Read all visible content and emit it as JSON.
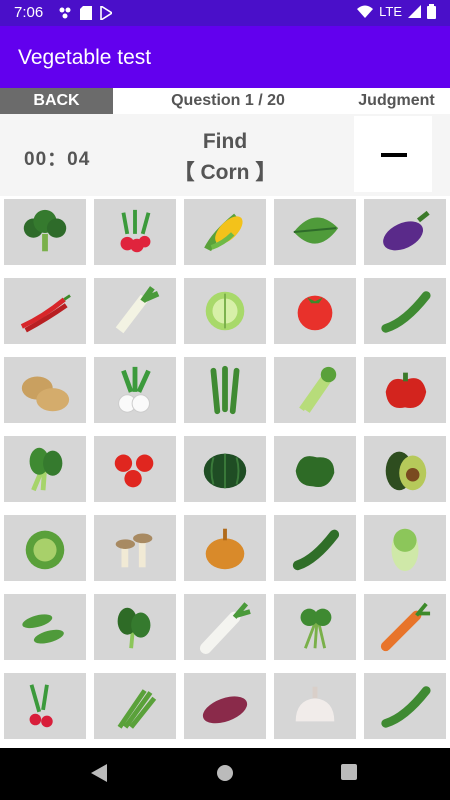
{
  "status": {
    "time": "7:06",
    "network": "LTE"
  },
  "app": {
    "title": "Vegetable test"
  },
  "header": {
    "back_label": "BACK",
    "question": "Question 1 / 20",
    "judgment_label": "Judgment"
  },
  "info": {
    "timer": "00：04",
    "find_line1": "Find",
    "find_line2": "【 Corn 】"
  },
  "colors": {
    "appbar": "#6200ee",
    "statusbar": "#4a0fc9",
    "cell_bg": "#d6d6d6",
    "back_bg": "#6b6b6b"
  },
  "grid": [
    [
      "broccoli-icon",
      "radish-icon",
      "corn-icon",
      "shiso-leaf-icon",
      "eggplant-icon"
    ],
    [
      "red-chili-icon",
      "leek-icon",
      "lettuce-icon",
      "tomato-icon",
      "cucumber-icon"
    ],
    [
      "potato-icon",
      "turnip-icon",
      "okra-icon",
      "celery-icon",
      "red-paprika-icon"
    ],
    [
      "komatsuna-icon",
      "cherry-tomato-icon",
      "kabocha-icon",
      "green-pepper-icon",
      "avocado-icon"
    ],
    [
      "cabbage-icon",
      "mushroom-icon",
      "onion-icon",
      "zucchini-icon",
      "napa-cabbage-icon"
    ],
    [
      "edamame-icon",
      "spinach-icon",
      "daikon-icon",
      "parsley-icon",
      "carrot-icon"
    ],
    [
      "cherry-radish-icon",
      "asparagus-icon",
      "sweet-potato-icon",
      "garlic-icon",
      "cucumber-icon"
    ]
  ]
}
